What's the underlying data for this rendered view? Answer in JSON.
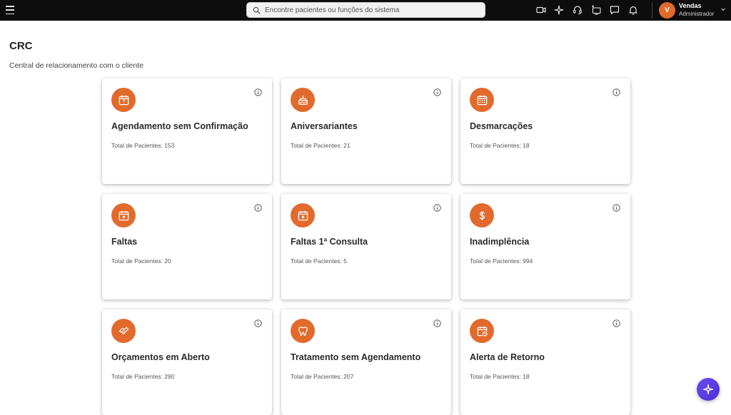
{
  "topbar": {
    "search_placeholder": "Encontre pacientes ou funções do sistema",
    "icons": [
      "video-icon",
      "sparkle-icon",
      "headset-icon",
      "screen-share-icon",
      "chat-icon",
      "bell-icon"
    ],
    "user": {
      "initial": "V",
      "name": "Vendas",
      "role": "Administrador"
    }
  },
  "page": {
    "title": "CRC",
    "subtitle": "Central de relacionamento com o cliente"
  },
  "cards": [
    {
      "icon": "calendar-question-icon",
      "title": "Agendamento sem Confirmação",
      "count": "Total de Pacientes: 153"
    },
    {
      "icon": "birthday-cake-icon",
      "title": "Aniversariantes",
      "count": "Total de Pacientes: 21"
    },
    {
      "icon": "calendar-grid-icon",
      "title": "Desmarcações",
      "count": "Total de Pacientes: 18"
    },
    {
      "icon": "calendar-x-icon",
      "title": "Faltas",
      "count": "Total de Pacientes: 20"
    },
    {
      "icon": "calendar-x-icon",
      "title": "Faltas 1ª Consulta",
      "count": "Total de Pacientes: 5"
    },
    {
      "icon": "dollar-icon",
      "title": "Inadimplência",
      "count": "Total de Pacientes: 994"
    },
    {
      "icon": "handshake-icon",
      "title": "Orçamentos em Aberto",
      "count": "Total de Pacientes: 290"
    },
    {
      "icon": "tooth-icon",
      "title": "Tratamento sem Agendamento",
      "count": "Total de Pacientes: 207"
    },
    {
      "icon": "calendar-clock-icon",
      "title": "Alerta de Retorno",
      "count": "Total de Pacientes: 18"
    }
  ],
  "colors": {
    "accent": "#e26a2c",
    "topbar": "#0d0d0d",
    "fab": "#5a3de6"
  }
}
